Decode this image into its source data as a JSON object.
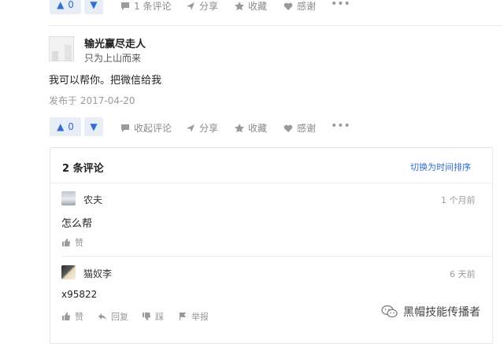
{
  "top_bar": {
    "vote_count": "0",
    "comments": "1 条评论",
    "share": "分享",
    "collect": "收藏",
    "thanks": "感谢"
  },
  "answer": {
    "user_name": "输光赢尽走人",
    "user_bio": "只为上山而来",
    "content": "我可以帮你。把微信给我",
    "posted": "发布于 2017-04-20",
    "vote_count": "0",
    "collapse_comments": "收起评论",
    "share": "分享",
    "collect": "收藏",
    "thanks": "感谢"
  },
  "comments_panel": {
    "count_title": "2 条评论",
    "sort_toggle": "切换为时间排序",
    "items": [
      {
        "user": "农夫",
        "time": "1 个月前",
        "text": "怎么帮",
        "like": "赞"
      },
      {
        "user": "猫奴李",
        "time": "6 天前",
        "text": "x95822",
        "like": "赞",
        "reply": "回复",
        "dislike": "踩",
        "report": "举报"
      }
    ]
  },
  "watermark": "黑帽技能传播者",
  "colors": {
    "accent": "#2f6fd0",
    "vote_bg": "#e8eef7",
    "muted": "#8a8a8a"
  }
}
